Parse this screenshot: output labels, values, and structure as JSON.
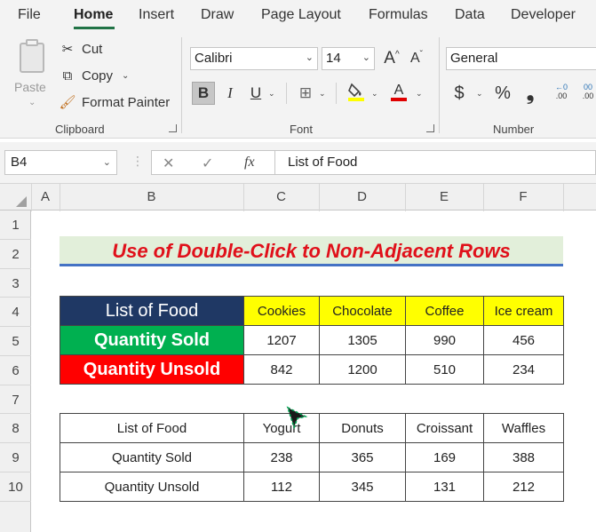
{
  "tabs": [
    "File",
    "Home",
    "Insert",
    "Draw",
    "Page Layout",
    "Formulas",
    "Data",
    "Developer"
  ],
  "clipboard": {
    "paste_label": "Paste",
    "cut_label": "Cut",
    "copy_label": "Copy",
    "format_painter_label": "Format Painter",
    "group_label": "Clipboard"
  },
  "font": {
    "family": "Calibri",
    "size": "14",
    "group_label": "Font",
    "bold": "B",
    "italic": "I",
    "underline": "U",
    "grow_label": "A",
    "shrink_label": "A",
    "font_color_label": "A"
  },
  "number": {
    "format": "General",
    "group_label": "Number",
    "currency": "$",
    "percent": "%",
    "comma": "❟",
    "inc_decimal": ".00",
    "dec_decimal": ".00"
  },
  "formula_bar": {
    "name_box": "B4",
    "fx": "fx",
    "content": "List of Food"
  },
  "columns": [
    "A",
    "B",
    "C",
    "D",
    "E",
    "F"
  ],
  "rows": [
    "1",
    "2",
    "3",
    "4",
    "5",
    "6",
    "7",
    "8",
    "9",
    "10"
  ],
  "sheet": {
    "title": "Use of Double-Click to Non-Adjacent Rows",
    "table1": {
      "header": [
        "List of Food",
        "Cookies",
        "Chocolate",
        "Coffee",
        "Ice cream"
      ],
      "rows": [
        [
          "Quantity Sold",
          "1207",
          "1305",
          "990",
          "456"
        ],
        [
          "Quantity Unsold",
          "842",
          "1200",
          "510",
          "234"
        ]
      ]
    },
    "table2": {
      "header": [
        "List of Food",
        "Yogurt",
        "Donuts",
        "Croissant",
        "Waffles"
      ],
      "rows": [
        [
          "Quantity Sold",
          "238",
          "365",
          "169",
          "388"
        ],
        [
          "Quantity Unsold",
          "112",
          "345",
          "131",
          "212"
        ]
      ]
    }
  },
  "colors": {
    "accent": "#217346",
    "title_red": "#e0101a",
    "navy": "#1f3864",
    "green": "#00b050",
    "red": "#ff0000",
    "yellow": "#ffff00"
  }
}
